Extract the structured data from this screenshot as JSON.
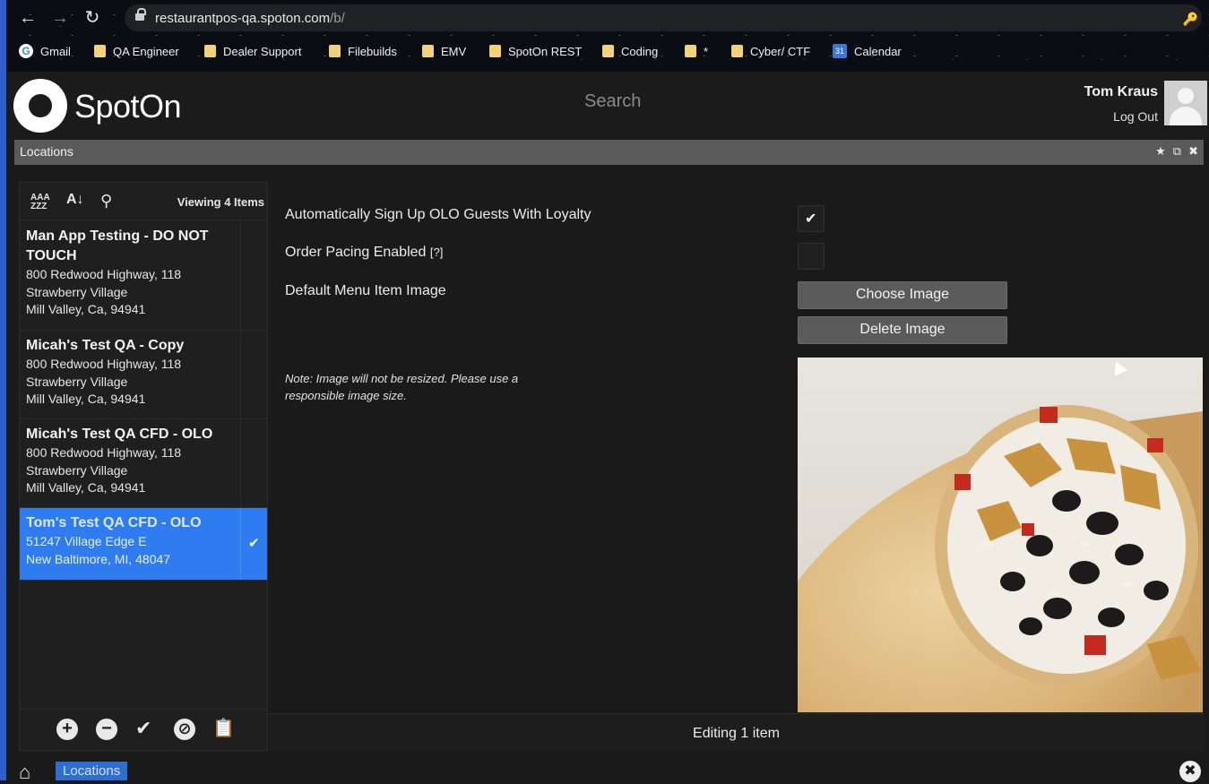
{
  "browser": {
    "url_host": "restaurantpos-qa.spoton.com",
    "url_path": "/b/",
    "bookmarks": [
      {
        "label": "Gmail",
        "icon": "google-icon"
      },
      {
        "label": "QA Engineer",
        "icon": "folder-icon"
      },
      {
        "label": "Dealer Support",
        "icon": "folder-icon"
      },
      {
        "label": "Filebuilds",
        "icon": "folder-icon"
      },
      {
        "label": "EMV",
        "icon": "folder-icon"
      },
      {
        "label": "SpotOn REST",
        "icon": "folder-icon"
      },
      {
        "label": "Coding",
        "icon": "folder-icon"
      },
      {
        "label": "*",
        "icon": "folder-icon"
      },
      {
        "label": "Cyber/ CTF",
        "icon": "folder-icon"
      },
      {
        "label": "Calendar",
        "icon": "calendar-icon"
      }
    ]
  },
  "header": {
    "logo_text": "SpotOn",
    "search_placeholder": "Search",
    "user_name": "Tom Kraus",
    "logout_label": "Log Out"
  },
  "panel": {
    "title": "Locations"
  },
  "list": {
    "viewing_text": "Viewing 4 Items",
    "items": [
      {
        "title": "Man App Testing - DO NOT TOUCH",
        "line1": "800 Redwood Highway, 118",
        "line2": "Strawberry Village",
        "line3": "Mill Valley, Ca, 94941",
        "selected": false
      },
      {
        "title": "Micah's Test QA - Copy",
        "line1": "800 Redwood Highway, 118",
        "line2": "Strawberry Village",
        "line3": "Mill Valley, Ca, 94941",
        "selected": false
      },
      {
        "title": "Micah's Test QA CFD - OLO",
        "line1": "800 Redwood Highway, 118",
        "line2": "Strawberry Village",
        "line3": "Mill Valley, Ca, 94941",
        "selected": false
      },
      {
        "title": "Tom's Test QA CFD - OLO",
        "line1": "51247 Village Edge E",
        "line2": "New Baltimore, MI, 48047",
        "line3": "",
        "selected": true
      }
    ]
  },
  "form": {
    "auto_signup_label": "Automatically Sign Up OLO Guests With Loyalty",
    "auto_signup_checked": true,
    "order_pacing_label": "Order Pacing Enabled",
    "order_pacing_hint": "[?]",
    "order_pacing_checked": false,
    "default_image_label": "Default Menu Item Image",
    "choose_image_label": "Choose Image",
    "delete_image_label": "Delete Image",
    "note": "Note: Image will not be resized. Please use a responsible image size."
  },
  "status": {
    "editing_text": "Editing 1 item"
  },
  "bottom": {
    "tab_label": "Locations"
  },
  "colors": {
    "accent": "#2f7cf0",
    "panel_bg": "#1a1a1a",
    "titlebar_bg": "#5a5a5a",
    "button_bg": "#5b5b5b"
  }
}
